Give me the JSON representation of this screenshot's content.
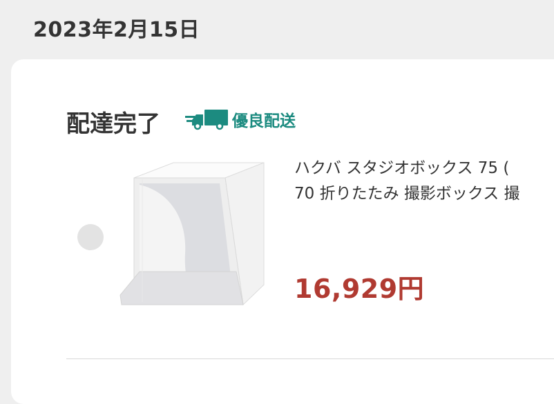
{
  "order": {
    "date": "2023年2月15日"
  },
  "shipment": {
    "status": "配達完了",
    "badge_label": "優良配送",
    "badge_icon": "delivery-truck-icon",
    "badge_color": "#1c8b80"
  },
  "item": {
    "title": "ハクバ スタジオボックス 75 (\n70 折りたたみ 撮影ボックス 撮",
    "price": "16,929円",
    "price_color": "#b03a31",
    "image": "photo-studio-box-image"
  }
}
